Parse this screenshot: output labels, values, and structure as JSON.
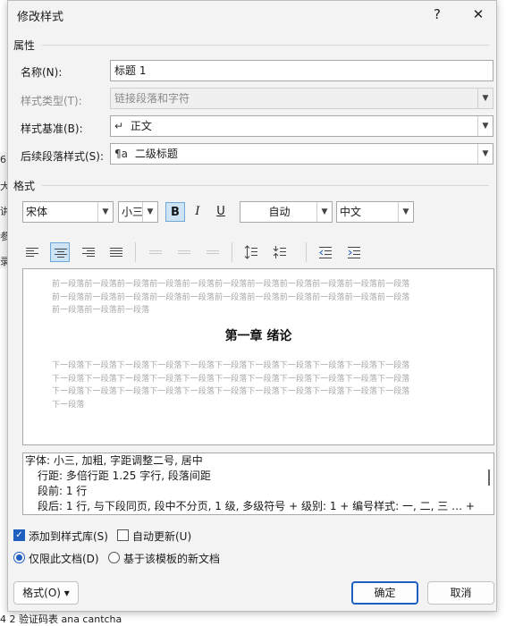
{
  "dialog": {
    "title": "修改样式",
    "help_label": "?",
    "close_label": "✕"
  },
  "properties": {
    "section_label": "属性",
    "name_label": "名称(N):",
    "name_value": "标题 1",
    "type_label": "样式类型(T):",
    "type_value": "链接段落和字符",
    "based_label": "样式基准(B):",
    "based_prefix": "↵",
    "based_value": "正文",
    "next_label": "后续段落样式(S):",
    "next_prefix": "¶a",
    "next_value": "二级标题"
  },
  "format": {
    "section_label": "格式",
    "font": "宋体",
    "size": "小三",
    "bold": "B",
    "italic": "I",
    "underline": "U",
    "color": "自动",
    "language": "中文",
    "bold_active": true
  },
  "toolbar": {
    "icons": [
      "align-left-icon",
      "align-center-icon",
      "align-right-icon",
      "justify-icon",
      "distributed-disabled-icon",
      "center-disabled-icon",
      "right-disabled-icon",
      "line-spacing-increase-icon",
      "line-spacing-decrease-icon",
      "decrease-indent-icon",
      "increase-indent-icon"
    ],
    "active": "align-center-icon"
  },
  "preview": {
    "before_lines": [
      "前一段落前一段落前一段落前一段落前一段落前一段落前一段落前一段落前一段落前一段落前一段落",
      "前一段落前一段落前一段落前一段落前一段落前一段落前一段落前一段落前一段落前一段落前一段落",
      "前一段落前一段落前一段落"
    ],
    "heading": "第一章  绪论",
    "after_lines": [
      "下一段落下一段落下一段落下一段落下一段落下一段落下一段落下一段落下一段落下一段落下一段落",
      "下一段落下一段落下一段落下一段落下一段落下一段落下一段落下一段落下一段落下一段落下一段落",
      "下一段落下一段落下一段落下一段落下一段落下一段落下一段落下一段落下一段落下一段落下一段落",
      "下一段落"
    ]
  },
  "description": {
    "line1": "字体: 小三, 加粗, 字距调整二号, 居中",
    "line2": "行距: 多倍行距 1.25 字行, 段落间距",
    "line3": "段前: 1 行",
    "line4": "段后: 1 行, 与下段同页, 段中不分页, 1 级, 多级符号 + 级别: 1 + 编号样式: 一, 二, 三 … +"
  },
  "options": {
    "add_to_gallery": "添加到样式库(S)",
    "add_to_gallery_checked": true,
    "auto_update": "自动更新(U)",
    "auto_update_checked": false,
    "this_doc_only": "仅限此文档(D)",
    "new_docs": "基于该模板的新文档",
    "selected_scope": "this_doc_only"
  },
  "buttons": {
    "format": "格式(O)",
    "format_arrow": "▾",
    "ok": "确定",
    "cancel": "取消"
  },
  "background": {
    "left_chars": [
      "6",
      "大",
      "讲",
      "参",
      "录"
    ],
    "bottom_text": "4 2 验证码表   ana   cantcha"
  }
}
